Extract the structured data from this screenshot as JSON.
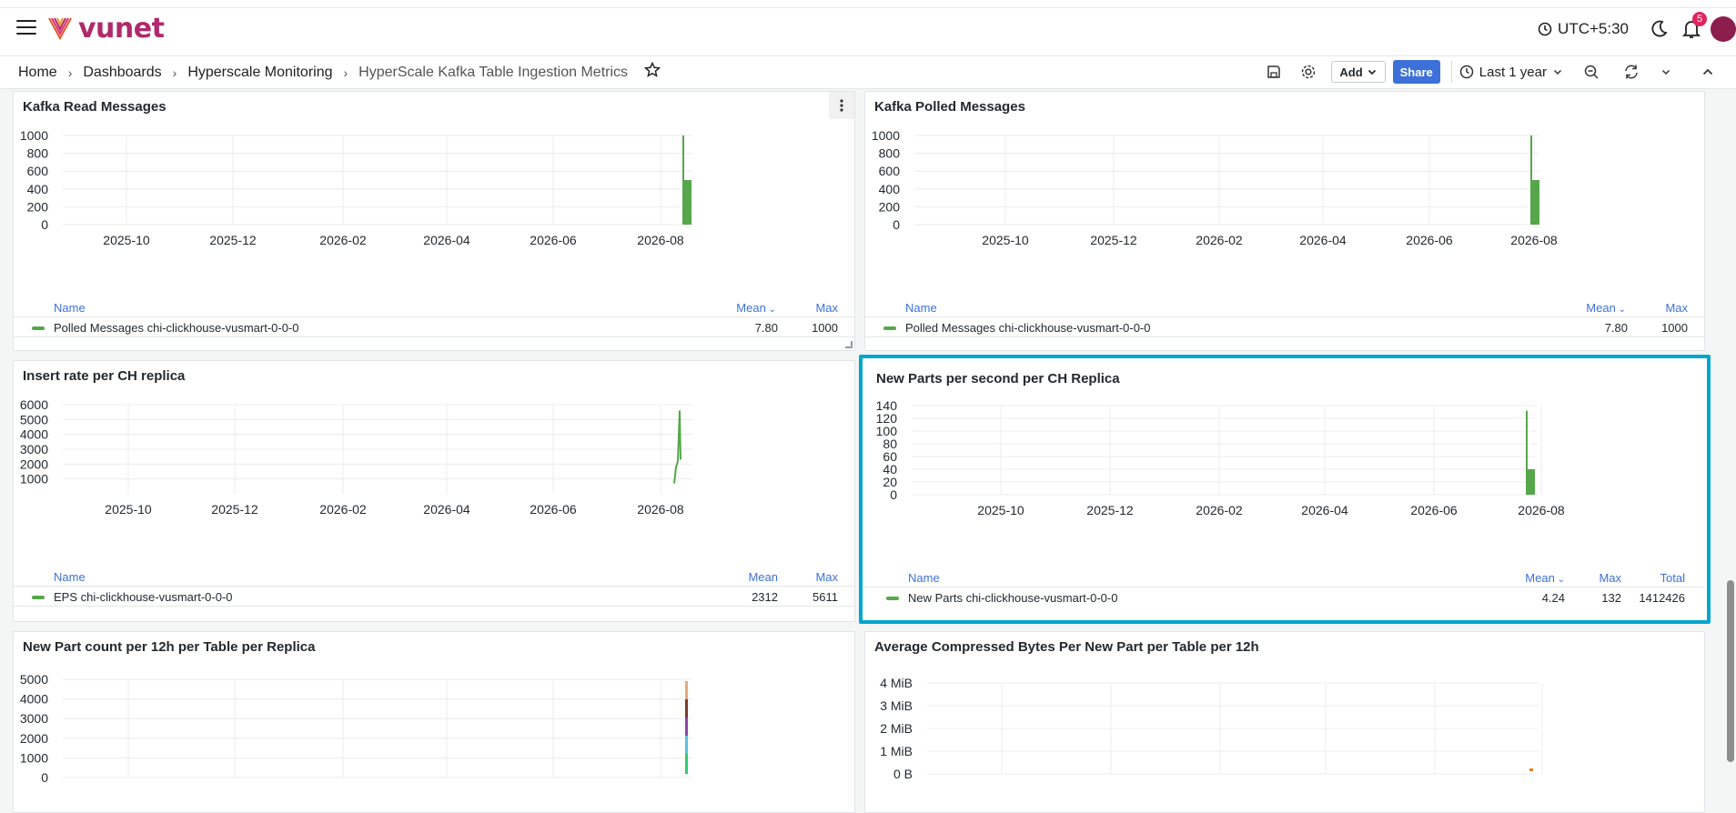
{
  "app": {
    "logo_text": "vunet",
    "timezone": "UTC+5:30",
    "notification_count": "5",
    "accent": "#3d71d9",
    "brand": "#b02a6b"
  },
  "breadcrumb": {
    "items": [
      "Home",
      "Dashboards",
      "Hyperscale Monitoring",
      "HyperScale Kafka Table Ingestion Metrics"
    ]
  },
  "toolbar": {
    "add_label": "Add",
    "share_label": "Share",
    "time_range": "Last 1 year",
    "icons": [
      "save-icon",
      "gear-icon",
      "clock-icon",
      "zoom-out-icon",
      "refresh-icon",
      "chevron-down-icon",
      "chevron-up-icon"
    ]
  },
  "panels": {
    "p1": {
      "title": "Kafka Read Messages",
      "legend_headers": [
        "Name",
        "Mean",
        "Max"
      ],
      "legend_row": {
        "name": "Polled Messages chi-clickhouse-vusmart-0-0-0",
        "mean": "7.80",
        "max": "1000"
      }
    },
    "p2": {
      "title": "Kafka Polled Messages",
      "legend_headers": [
        "Name",
        "Mean",
        "Max"
      ],
      "legend_row": {
        "name": "Polled Messages chi-clickhouse-vusmart-0-0-0",
        "mean": "7.80",
        "max": "1000"
      }
    },
    "p3": {
      "title": "Insert rate per CH replica",
      "legend_headers": [
        "Name",
        "Mean",
        "Max"
      ],
      "legend_row": {
        "name": "EPS chi-clickhouse-vusmart-0-0-0",
        "mean": "2312",
        "max": "5611"
      }
    },
    "p4": {
      "title": "New Parts per second per CH Replica",
      "legend_headers": [
        "Name",
        "Mean",
        "Max",
        "Total"
      ],
      "legend_row": {
        "name": "New Parts chi-clickhouse-vusmart-0-0-0",
        "mean": "4.24",
        "max": "132",
        "total": "1412426"
      }
    },
    "p5": {
      "title": "New Part count per 12h per Table per Replica"
    },
    "p6": {
      "title": "Average Compressed Bytes Per New Part per Table per 12h"
    }
  },
  "chart_data": [
    {
      "type": "bar",
      "title": "Kafka Read Messages",
      "x_ticks": [
        "2025-10",
        "2025-12",
        "2026-02",
        "2026-04",
        "2026-06",
        "2026-08"
      ],
      "y_ticks": [
        "0",
        "200",
        "400",
        "600",
        "800",
        "1000"
      ],
      "ylim": [
        0,
        1000
      ],
      "series": [
        {
          "name": "Polled Messages chi-clickhouse-vusmart-0-0-0",
          "color": "#56a64b",
          "spike_peak": 1000,
          "spike_plateau": 500
        }
      ]
    },
    {
      "type": "bar",
      "title": "Kafka Polled Messages",
      "x_ticks": [
        "2025-10",
        "2025-12",
        "2026-02",
        "2026-04",
        "2026-06",
        "2026-08"
      ],
      "y_ticks": [
        "0",
        "200",
        "400",
        "600",
        "800",
        "1000"
      ],
      "ylim": [
        0,
        1000
      ],
      "series": [
        {
          "name": "Polled Messages chi-clickhouse-vusmart-0-0-0",
          "color": "#56a64b",
          "spike_peak": 1000,
          "spike_plateau": 500
        }
      ]
    },
    {
      "type": "line",
      "title": "Insert rate per CH replica",
      "x_ticks": [
        "2025-10",
        "2025-12",
        "2026-02",
        "2026-04",
        "2026-06",
        "2026-08"
      ],
      "y_ticks": [
        "1000",
        "2000",
        "3000",
        "4000",
        "5000",
        "6000"
      ],
      "ylim": [
        0,
        6000
      ],
      "series": [
        {
          "name": "EPS chi-clickhouse-vusmart-0-0-0",
          "color": "#56a64b",
          "spike_peak": 5611,
          "spike_plateau": 2300
        }
      ]
    },
    {
      "type": "bar",
      "title": "New Parts per second per CH Replica",
      "x_ticks": [
        "2025-10",
        "2025-12",
        "2026-02",
        "2026-04",
        "2026-06",
        "2026-08"
      ],
      "y_ticks": [
        "0",
        "20",
        "40",
        "60",
        "80",
        "100",
        "120",
        "140"
      ],
      "ylim": [
        0,
        140
      ],
      "series": [
        {
          "name": "New Parts chi-clickhouse-vusmart-0-0-0",
          "color": "#56a64b",
          "spike_peak": 132,
          "spike_plateau": 40
        }
      ]
    },
    {
      "type": "line",
      "title": "New Part count per 12h per Table per Replica",
      "y_ticks": [
        "0",
        "1000",
        "2000",
        "3000",
        "4000",
        "5000"
      ],
      "ylim": [
        0,
        5000
      ]
    },
    {
      "type": "line",
      "title": "Average Compressed Bytes Per New Part per Table per 12h",
      "y_ticks": [
        "0 B",
        "1 MiB",
        "2 MiB",
        "3 MiB",
        "4 MiB"
      ],
      "ylim": [
        0,
        4
      ]
    }
  ]
}
